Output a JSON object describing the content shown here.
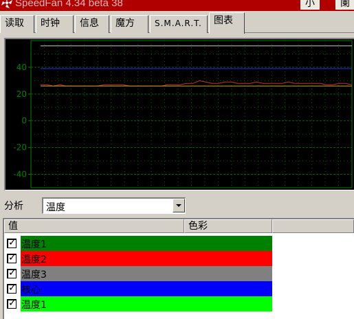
{
  "window": {
    "title": "SpeedFan 4.34 beta 38",
    "minimize_glyph": "小",
    "close_glyph": "阑"
  },
  "tabs": [
    {
      "label": "读取"
    },
    {
      "label": "时钟"
    },
    {
      "label": "信息"
    },
    {
      "label": "魔方"
    },
    {
      "label": "S.M.A.R.T."
    },
    {
      "label": "图表"
    }
  ],
  "chart_data": {
    "type": "line",
    "y_ticks": [
      "40",
      "20",
      "0",
      "-20",
      "-40"
    ],
    "ylim": [
      -50,
      60
    ],
    "grid": true,
    "series": [
      {
        "color": "#c83232",
        "values": [
          27,
          27,
          26,
          27,
          26,
          26,
          26,
          26,
          26,
          26,
          27,
          27,
          27,
          27,
          26,
          26,
          26,
          26,
          26,
          26,
          27,
          27,
          27,
          28,
          28,
          30,
          29,
          28,
          28,
          29,
          29,
          28,
          28,
          28,
          29,
          28,
          28,
          28,
          28,
          29,
          28,
          28,
          28,
          28,
          28,
          27,
          27,
          28,
          28,
          27
        ]
      },
      {
        "color": "#2828ff",
        "values": [
          39,
          39,
          39,
          39,
          39,
          39,
          39,
          39,
          39,
          39,
          39,
          39,
          39,
          39,
          39,
          39,
          39,
          39,
          39,
          39,
          39,
          39,
          39,
          39,
          39,
          39,
          39,
          39,
          39,
          39,
          39,
          39,
          39,
          39,
          39,
          39,
          39,
          39,
          39,
          39,
          39,
          39,
          39,
          39,
          39,
          39,
          39,
          39,
          39,
          39
        ]
      },
      {
        "color": "#c8c8c8",
        "values": [
          56,
          56,
          56,
          56,
          56,
          56,
          56,
          56,
          56,
          56,
          56,
          56,
          56,
          56,
          56,
          56,
          56,
          56,
          56,
          56,
          56,
          56,
          56,
          56,
          56,
          56,
          56,
          56,
          56,
          56,
          56,
          56,
          56,
          56,
          56,
          56,
          56,
          56,
          56,
          56,
          56,
          56,
          56,
          56,
          56,
          56,
          56,
          56,
          56,
          56
        ]
      },
      {
        "color": "#c8a032",
        "values": [
          26,
          26,
          26,
          26,
          26,
          26,
          26,
          26,
          26,
          26,
          26,
          26,
          26,
          26,
          26,
          26,
          26,
          26,
          26,
          26,
          26,
          26,
          26,
          26,
          26,
          26,
          26,
          26,
          26,
          26,
          26,
          26,
          26,
          26,
          26,
          26,
          26,
          26,
          26,
          26,
          26,
          26,
          26,
          26,
          26,
          26,
          26,
          26,
          26,
          26
        ]
      }
    ]
  },
  "analysis": {
    "label": "分析",
    "selected": "温度"
  },
  "list": {
    "columns": [
      "值",
      "色彩"
    ],
    "rows": [
      {
        "label": "温度1",
        "color": "#008000",
        "checked": true
      },
      {
        "label": "温度2",
        "color": "#ff0000",
        "checked": true
      },
      {
        "label": "温度3",
        "color": "#808080",
        "checked": true
      },
      {
        "label": "核心",
        "color": "#0000ff",
        "checked": true
      },
      {
        "label": "温度1",
        "color": "#00ff00",
        "checked": true
      }
    ]
  }
}
